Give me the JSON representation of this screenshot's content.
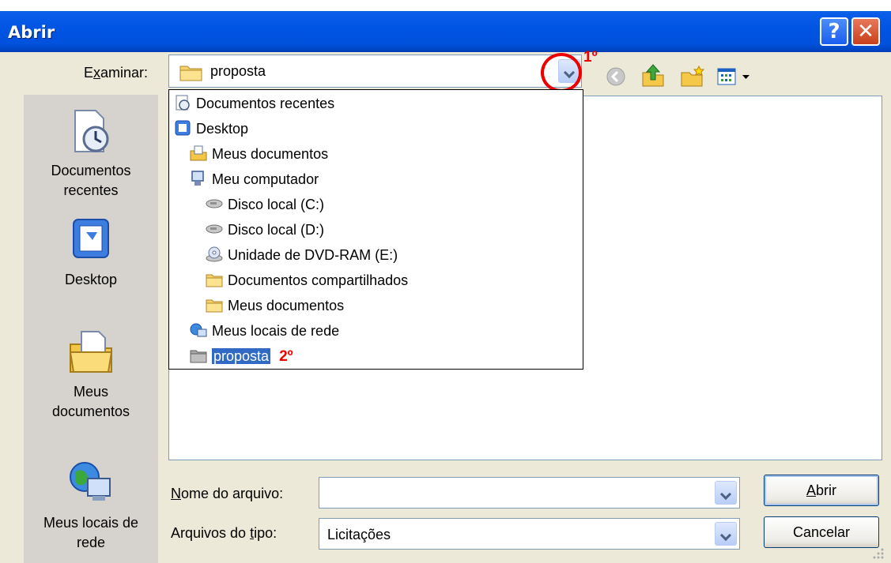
{
  "window": {
    "title": "Abrir",
    "help_glyph": "?",
    "close_glyph": "✕"
  },
  "lookin": {
    "label_prefix": "E",
    "label_underlined": "x",
    "label_suffix": "aminar:",
    "value": "proposta",
    "annotation_1": "1º"
  },
  "toolbar": {
    "icons": [
      "back-icon",
      "up-folder-icon",
      "new-folder-icon",
      "view-menu-icon"
    ]
  },
  "places": [
    {
      "line1": "Documentos",
      "line2": "recentes",
      "icon": "recent-documents-icon"
    },
    {
      "line1": "Desktop",
      "line2": "",
      "icon": "desktop-icon"
    },
    {
      "line1": "Meus",
      "line2": "documentos",
      "icon": "my-documents-icon"
    },
    {
      "line1": "Meus locais de",
      "line2": "rede",
      "icon": "network-places-icon"
    }
  ],
  "dropdown": {
    "items": [
      {
        "label": "Documentos recentes",
        "icon": "recent-documents-icon"
      },
      {
        "label": "Desktop",
        "icon": "desktop-icon"
      },
      {
        "label": "Meus documentos",
        "icon": "my-documents-icon"
      },
      {
        "label": "Meu computador",
        "icon": "computer-icon"
      },
      {
        "label": "Disco local (C:)",
        "icon": "drive-icon"
      },
      {
        "label": "Disco local (D:)",
        "icon": "drive-icon"
      },
      {
        "label": "Unidade de DVD-RAM (E:)",
        "icon": "dvd-drive-icon"
      },
      {
        "label": "Documentos compartilhados",
        "icon": "folder-icon"
      },
      {
        "label": "Meus documentos",
        "icon": "folder-icon"
      },
      {
        "label": "Meus locais de rede",
        "icon": "network-places-icon"
      },
      {
        "label": "proposta",
        "icon": "folder-icon",
        "selected": true
      }
    ],
    "annotation_2": "2º"
  },
  "filename": {
    "label_underlined": "N",
    "label_suffix": "ome do arquivo:",
    "value": ""
  },
  "filetype": {
    "label_prefix": "Arquivos do ",
    "label_underlined": "t",
    "label_suffix": "ipo:",
    "value": "Licitações"
  },
  "buttons": {
    "open_underlined": "A",
    "open_suffix": "brir",
    "cancel": "Cancelar"
  },
  "colors": {
    "selection": "#316ac5",
    "annotation": "#e00000",
    "titlebar": "#0054e3"
  }
}
